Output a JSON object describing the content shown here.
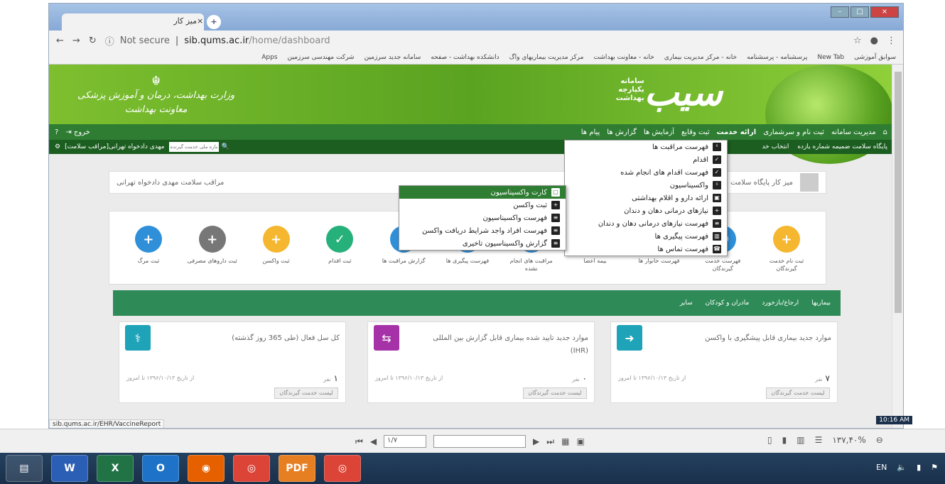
{
  "browser": {
    "tab_title": "میز کار",
    "url_secure": "Not secure",
    "url_host": "sib.qums.ac.ir",
    "url_path": "/home/dashboard",
    "bookmarks": [
      "Apps",
      "شرکت مهندسی سرزمین",
      "سامانه جدید سرزمین",
      "دانشکده بهداشت - صفحه",
      "مرکز مدیریت بیماریهای واگ",
      "خانه - معاونت بهداشت",
      "خانه - مرکز مدیریت بیماری",
      "پرسشنامه - پرسشنامه",
      "New Tab",
      "سوابق آموزشی"
    ],
    "status_url": "sib.qums.ac.ir/EHR/VaccineReport"
  },
  "header": {
    "left_logo_line1": "وزارت بهداشت، درمان و آموزش پزشکی",
    "left_logo_line2": "معاونت بهداشت",
    "brand": "سیب",
    "brand_sub": "سامانه یکپارچه بهداشت"
  },
  "nav": {
    "items": [
      "مدیریت سامانه",
      "ثبت نام و سرشماری",
      "ارائه خدمت",
      "ثبت وقایع",
      "آزمایش ها",
      "گزارش ها",
      "پیام ها"
    ],
    "exit": "خروج"
  },
  "subnav": {
    "facility": "پایگاه سلامت ضمیمه شماره یازده",
    "select_label": "انتخاب خد",
    "search_placeholder": "شماره ملی خدمت گیرنده",
    "user": "مهدی دادخواه تهرانی[مراقب سلامت]"
  },
  "desk": {
    "title": "میز کار پایگاه سلامت ش",
    "user": "مراقب سلامت مهدی دادخواه تهرانی"
  },
  "icons": [
    {
      "label": "ثبت نام خدمت گیرندگان",
      "color": "#f5b72f",
      "glyph": "+"
    },
    {
      "label": "فهرست خدمت گیرندگان",
      "color": "#2f8fd8",
      "glyph": "☻"
    },
    {
      "label": "فهرست خانوار ها",
      "color": "#2f8fd8",
      "glyph": "⌂"
    },
    {
      "label": "بیمه اعضا",
      "color": "#2f8fd8",
      "glyph": "✚"
    },
    {
      "label": "مراقبت های انجام نشده",
      "color": "#2f8fd8",
      "glyph": "!"
    },
    {
      "label": "فهرست پیگیری ها",
      "color": "#2f8fd8",
      "glyph": "≡"
    },
    {
      "label": "گزارش مراقبت ها",
      "color": "#2f8fd8",
      "glyph": "▤"
    },
    {
      "label": "ثبت اقدام",
      "color": "#26b07a",
      "glyph": "✓"
    },
    {
      "label": "ثبت واکسن",
      "color": "#f5b72f",
      "glyph": "+"
    },
    {
      "label": "ثبت داروهای مصرفی",
      "color": "#777",
      "glyph": "+"
    },
    {
      "label": "ثبت مرگ",
      "color": "#2f8fd8",
      "glyph": "+"
    }
  ],
  "tabs": [
    "بیماریها",
    "ارجاع/بازخورد",
    "مادران و کودکان",
    "سایر"
  ],
  "stats": [
    {
      "title": "موارد جدید بیماری قابل پیشگیری با واکسن",
      "count": "۷",
      "unit": "نفر",
      "from": "از تاریخ ۱۳۹۶/۱۰/۱۳ تا امروز",
      "button": "لیست خدمت گیرندگان",
      "color": "#1fa3b8",
      "glyph": "➜"
    },
    {
      "title": "موارد جدید تایید شده بیماری قابل گزارش بین المللی (IHR)",
      "count": "۰",
      "unit": "نفر",
      "from": "از تاریخ ۱۳۹۶/۱۰/۱۳ تا امروز",
      "button": "لیست خدمت گیرندگان",
      "color": "#a632a8",
      "glyph": "⇆"
    },
    {
      "title": "کل سل فعال (طی 365 روز گذشته)",
      "count": "۱",
      "unit": "نفر",
      "from": "از تاریخ ۱۳۹۶/۱۰/۱۳ تا امروز",
      "button": "لیست خدمت گیرندگان",
      "color": "#1fa3b8",
      "glyph": "⚕"
    }
  ],
  "menu_main": [
    "فهرست مراقبت ها",
    "اقدام",
    "فهرست اقدام های انجام شده",
    "واکسیناسیون",
    "ارائه دارو و اقلام بهداشتی",
    "نیازهای درمانی دهان و دندان",
    "فهرست نیازهای درمانی دهان و دندان",
    "فهرست پیگیری ها",
    "فهرست تماس ها"
  ],
  "menu_sub": [
    "کارت واکسیناسیون",
    "ثبت واکسن",
    "فهرست واکسیناسیون",
    "فهرست افراد واجد شرایط دریافت واکسن",
    "گزارش واکسیناسیون تاخیری"
  ],
  "pdf": {
    "page": "۱/۷",
    "zoom": "۱۳۷,۴۰%"
  },
  "taskbar": {
    "lang": "EN",
    "time": "10:16 AM"
  }
}
